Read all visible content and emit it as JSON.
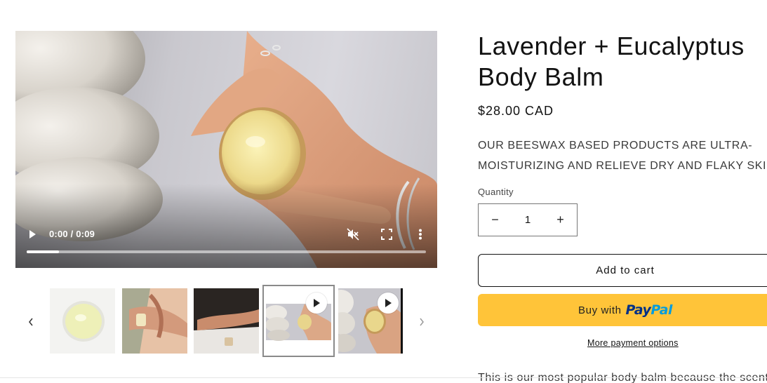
{
  "product": {
    "title": "Lavender + Eucalyptus Body Balm",
    "price": "$28.00 CAD",
    "description_line1": "OUR BEESWAX BASED PRODUCTS ARE ULTRA-",
    "description_line2": "MOISTURIZING AND RELIEVE DRY AND FLAKY SKIN",
    "body_text": "This is our most popular body balm because the scent"
  },
  "video": {
    "time": "0:00 / 0:09",
    "progress": 0.08,
    "icons": [
      "play-icon",
      "mute-icon",
      "fullscreen-icon",
      "more-vertical-icon"
    ]
  },
  "gallery": {
    "thumbnail_count": 5,
    "active_index": 3,
    "video_thumbnails": [
      3,
      4
    ],
    "icons": [
      "chevron-left-icon",
      "chevron-right-icon"
    ]
  },
  "quantity": {
    "label": "Quantity",
    "value": "1",
    "decrease_symbol": "−",
    "increase_symbol": "+"
  },
  "buttons": {
    "add_to_cart": "Add to cart",
    "buy_with": "Buy with",
    "paypal_pay": "Pay",
    "paypal_pal": "Pal",
    "more_payment_options": "More payment options"
  },
  "colors": {
    "paypal_yellow": "#ffc439",
    "paypal_dark_blue": "#003087",
    "paypal_light_blue": "#009cde",
    "text": "#121212"
  }
}
